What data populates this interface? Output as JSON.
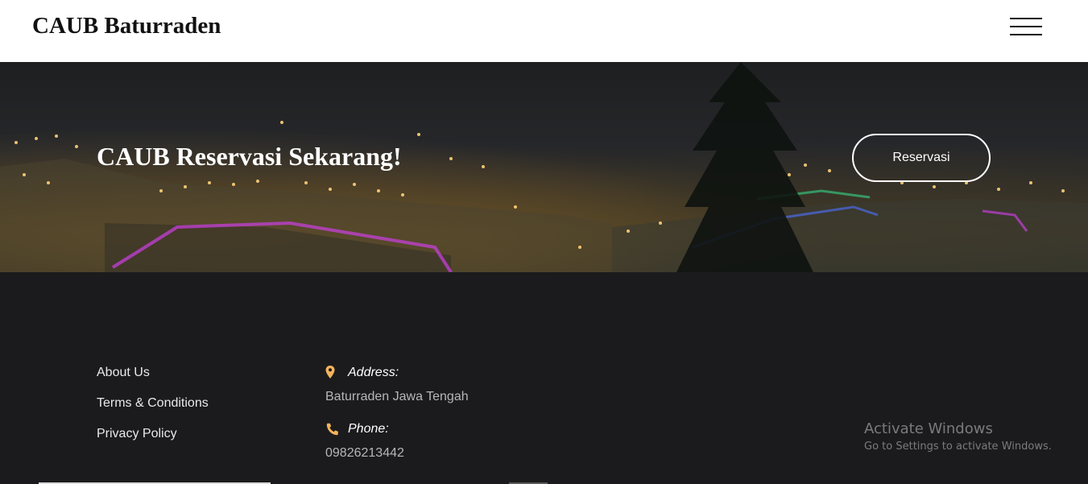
{
  "header": {
    "brand": "CAUB Baturraden",
    "menu_icon": "hamburger-menu-icon"
  },
  "hero": {
    "title": "CAUB Reservasi Sekarang!",
    "button_label": "Reservasi",
    "background": "night-scene-with-string-lights"
  },
  "footer": {
    "links": [
      {
        "label": "About Us"
      },
      {
        "label": "Terms & Conditions"
      },
      {
        "label": "Privacy Policy"
      }
    ],
    "contact": {
      "address_label": "Address:",
      "address_value": "Baturraden Jawa Tengah",
      "address_icon": "map-pin-icon",
      "phone_label": "Phone:",
      "phone_value": "09826213442",
      "phone_icon": "phone-icon",
      "icon_color": "#f4b35b"
    }
  },
  "watermark": {
    "title": "Activate Windows",
    "subtitle": "Go to Settings to activate Windows."
  },
  "colors": {
    "header_bg": "#ffffff",
    "footer_bg": "#1b1b1d",
    "accent": "#f4b35b"
  }
}
